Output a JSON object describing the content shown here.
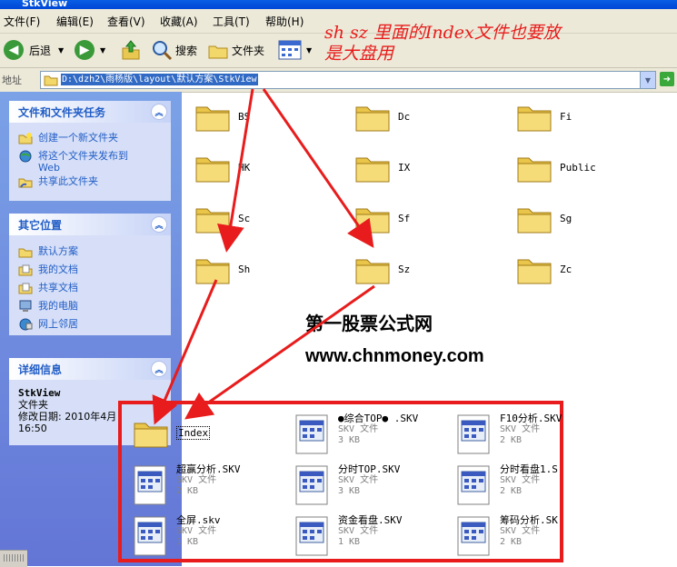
{
  "window": {
    "title": "StkView"
  },
  "menu": [
    {
      "label": "文件(F)"
    },
    {
      "label": "编辑(E)"
    },
    {
      "label": "查看(V)"
    },
    {
      "label": "收藏(A)"
    },
    {
      "label": "工具(T)"
    },
    {
      "label": "帮助(H)"
    }
  ],
  "toolbar": {
    "back_label": "后退",
    "search_label": "搜索",
    "folders_label": "文件夹"
  },
  "address": {
    "label": "地址",
    "value": "D:\\dzh2\\雨杨版\\layout\\默认方案\\StkView"
  },
  "annotation": {
    "line1": "sh  sz 里面的Index文件也要放",
    "line2": "是大盘用"
  },
  "left": {
    "tasks": {
      "title": "文件和文件夹任务",
      "items": [
        "创建一个新文件夹",
        "将这个文件夹发布到\nWeb",
        "共享此文件夹"
      ]
    },
    "places": {
      "title": "其它位置",
      "items": [
        "默认方案",
        "我的文档",
        "共享文档",
        "我的电脑",
        "网上邻居"
      ]
    },
    "details": {
      "title": "详细信息",
      "name": "StkView",
      "type": "文件夹",
      "modified": "修改日期: 2010年4月",
      "time": "16:50"
    }
  },
  "folders": [
    "BS",
    "Dc",
    "Fi",
    "HK",
    "IX",
    "Public",
    "Sc",
    "Sf",
    "Sg",
    "Sh",
    "Sz",
    "Zc"
  ],
  "watermark": {
    "title": "第一股票公式网",
    "url": "www.chnmoney.com"
  },
  "index_folder": "Index",
  "files": [
    {
      "name": "●综合TOP●  .SKV",
      "type": "SKV 文件",
      "size": "3 KB"
    },
    {
      "name": "F10分析.SKV",
      "type": "SKV 文件",
      "size": "2 KB"
    },
    {
      "name": "超赢分析.SKV",
      "type": "SKV 文件",
      "size": "2 KB"
    },
    {
      "name": "分时TOP.SKV",
      "type": "SKV 文件",
      "size": "3 KB"
    },
    {
      "name": "分时看盘1.S",
      "type": "SKV 文件",
      "size": "2 KB"
    },
    {
      "name": "全屏.skv",
      "type": "SKV 文件",
      "size": "1 KB"
    },
    {
      "name": "资金看盘.SKV",
      "type": "SKV 文件",
      "size": "1 KB"
    },
    {
      "name": "筹码分析.SK",
      "type": "SKV 文件",
      "size": "2 KB"
    }
  ],
  "colors": {
    "accent_red": "#e81c1c",
    "xp_blue": "#215dc6"
  }
}
